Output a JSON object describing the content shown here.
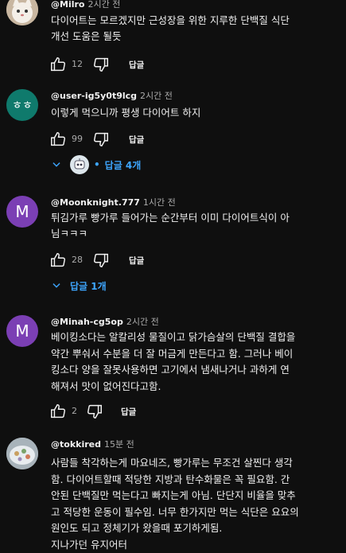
{
  "comments": [
    {
      "author": "@Milro",
      "time": "2시간 전",
      "text": "다이어트는 모르겠지만 근성장을 위한 지루한 단백질 식단\n개선 도움은 될듯",
      "likes": "12",
      "reply_label": "답글"
    },
    {
      "author": "@user-ig5y0t9lcg",
      "time": "2시간 전",
      "avatar_text": "ㅎㅎ",
      "text": "이렇게 먹으니까 평생 다이어트 하지",
      "likes": "99",
      "reply_label": "답글",
      "replies_label": "답글 4개"
    },
    {
      "author": "@Moonknight.777",
      "time": "1시간 전",
      "avatar_text": "M",
      "text": "튀김가루 빵가루 들어가는 순간부터 이미 다이어트식이 아\n님ㅋㅋㅋ",
      "likes": "28",
      "reply_label": "답글",
      "replies_label": "답글 1개"
    },
    {
      "author": "@Minah-cg5op",
      "time": "2시간 전",
      "avatar_text": "M",
      "text": "베이킹소다는 알칼리성 물질이고 닭가슴살의 단백질 결합을\n약간 뿌숴서 수분을 더 잘 머금게 만든다고 함. 그러나 베이\n킹소다 양을 잘못사용하면 고기에서 냄새나거나 과하게 연\n해져서 맛이 없어진다고함.",
      "likes": "2",
      "reply_label": "답글"
    },
    {
      "author": "@tokkired",
      "time": "15분 전",
      "text": "사람들 착각하는게 마요네즈, 빵가루는 무조건 살찐다 생각\n함. 다이어트할때 적당한 지방과 탄수화물은 꼭 필요함. 간\n안된 단백질만 먹는다고 빠지는게 아님. 단단지 비율을 맞추\n고 적당한 운동이 필수임. 너무 한가지만 먹는 식단은 요요의\n원인도 되고 정체기가 왔을때 포기하게됨.\n지나가던 유지어터"
    }
  ],
  "colors": {
    "background": "#0f0f0f",
    "link": "#3ea6ff",
    "avatar_green": "#0f7a6c",
    "avatar_purple": "#7b3fb4"
  }
}
